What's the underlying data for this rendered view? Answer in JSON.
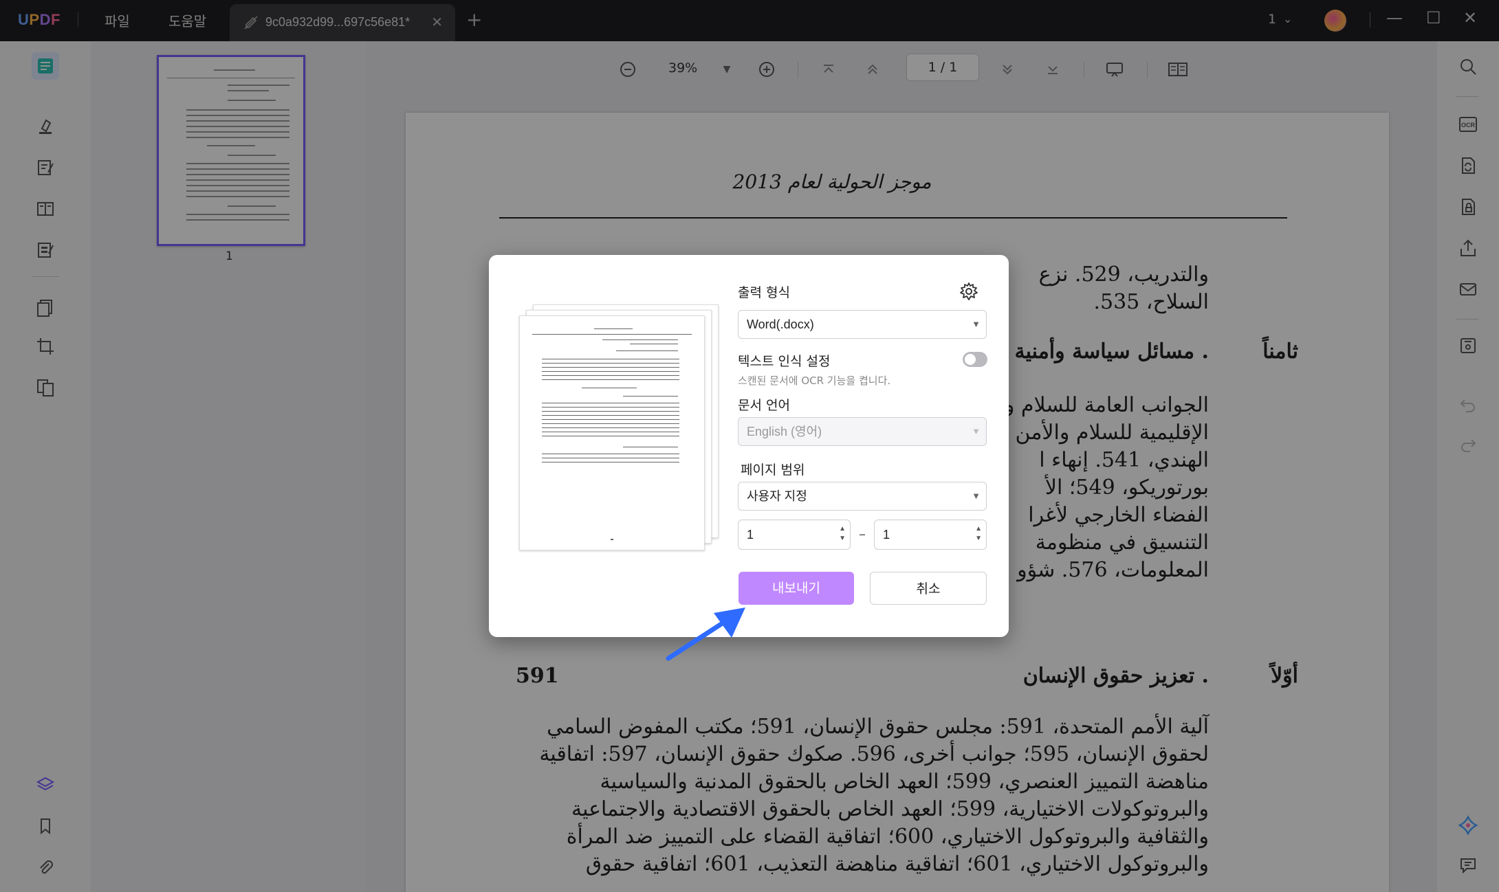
{
  "app": {
    "logo": "UPDF",
    "menu": [
      "파일",
      "도움말"
    ],
    "tab_title": "9c0a932d99...697c56e81*",
    "window_count": "1"
  },
  "toolbar": {
    "zoom": "39%",
    "page_indicator": "1 / 1"
  },
  "thumbnails": {
    "page_number": "1"
  },
  "document": {
    "title": "موجز الحولية لعام 2013",
    "lines_top": [
      "والتدريب، 529. نزع",
      "السلاح، 535."
    ],
    "section8_label": "ثامناً",
    "section8_heading": ". مسائل سياسة وأمنية",
    "section8_lines": [
      "الجوانب العامة للسلام و",
      "الإقليمية للسلام والأمن",
      "الهندي، 541. إنهاء ا",
      "بورتوريكو، 549؛ الأ",
      "الفضاء الخارجي لأغرا",
      "التنسيق في منظومة",
      "المعلومات، 576. شؤو"
    ],
    "section1_label": "أوّلاً",
    "section1_heading": ". تعزيز حقوق الإنسان",
    "section1_page": "591",
    "section1_lines": [
      "آلية الأمم المتحدة، 591: مجلس حقوق الإنسان، 591؛ مكتب المفوض السامي",
      "لحقوق الإنسان، 595؛ جوانب أخرى، 596. صكوك حقوق الإنسان، 597: اتفاقية",
      "مناهضة التمييز العنصري، 599؛ العهد الخاص بالحقوق المدنية والسياسية",
      "والبروتوكولات الاختيارية، 599؛ العهد الخاص بالحقوق الاقتصادية والاجتماعية",
      "والثقافية والبروتوكول الاختياري، 600؛ اتفاقية القضاء على التمييز ضد المرأة",
      "والبروتوكول الاختياري، 601؛ اتفاقية مناهضة التعذيب، 601؛ اتفاقية حقوق"
    ]
  },
  "dialog": {
    "output_format_label": "출력 형식",
    "output_format_value": "Word(.docx)",
    "ocr_label": "텍스트 인식 설정",
    "ocr_description": "스캔된 문서에 OCR 기능을 켭니다.",
    "ocr_enabled": false,
    "language_label": "문서 언어",
    "language_value": "English (영어)",
    "page_range_label": "페이지 범위",
    "page_range_value": "사용자 지정",
    "range_from": "1",
    "range_to": "1",
    "range_separator": "–",
    "export_button": "내보내기",
    "cancel_button": "취소"
  },
  "colors": {
    "accent_purple": "#c088ff",
    "selection_border": "#7b5cff",
    "arrow_blue": "#2f6bff",
    "titlebar_bg": "#1f1f22"
  },
  "icons": {
    "left_toolbar": [
      "reader-icon",
      "highlight-icon",
      "edit-text-icon",
      "organize-icon",
      "form-icon",
      "page-tools-icon",
      "crop-icon",
      "compare-icon",
      "layers-icon",
      "bookmark-icon",
      "attachment-icon"
    ],
    "right_toolbar": [
      "search-icon",
      "ocr-icon",
      "convert-icon",
      "protect-icon",
      "share-icon",
      "email-icon",
      "save-icon",
      "undo-icon",
      "redo-icon",
      "ai-assistant-icon",
      "comment-icon"
    ]
  }
}
